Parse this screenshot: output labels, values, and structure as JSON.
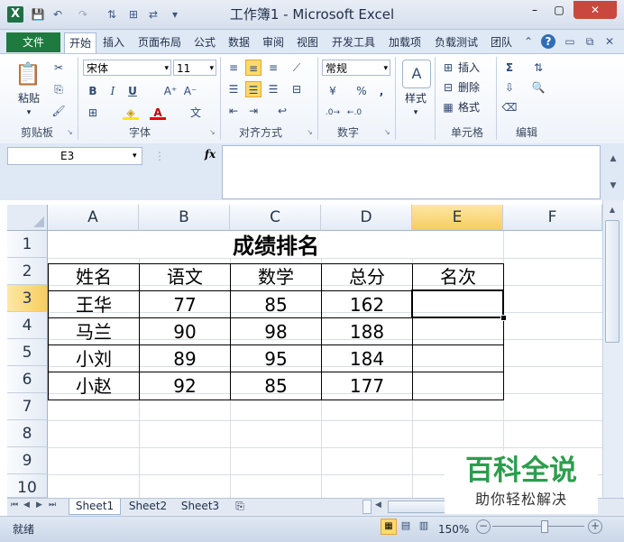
{
  "window": {
    "title": "工作簿1 - Microsoft Excel",
    "minimize": "–",
    "maximize": "▢",
    "close": "✕"
  },
  "ribbon_tabs": [
    "文件",
    "开始",
    "插入",
    "页面布局",
    "公式",
    "数据",
    "审阅",
    "视图",
    "开发工具",
    "加载项",
    "负载测试",
    "团队"
  ],
  "ribbon": {
    "clipboard": {
      "label": "剪贴板",
      "paste": "粘贴"
    },
    "font": {
      "label": "字体",
      "name": "宋体",
      "size": "11",
      "bold": "B",
      "italic": "I",
      "underline": "U"
    },
    "alignment": {
      "label": "对齐方式"
    },
    "number": {
      "label": "数字",
      "format": "常规",
      "percent": "%",
      "comma": ","
    },
    "styles": {
      "label": "样式",
      "button": "样式"
    },
    "cells": {
      "label": "单元格",
      "insert": "插入",
      "delete": "删除",
      "format": "格式"
    },
    "editing": {
      "label": "编辑",
      "sum": "Σ"
    }
  },
  "formula_bar": {
    "name_box": "E3",
    "fx": "fx",
    "formula": ""
  },
  "columns": [
    "A",
    "B",
    "C",
    "D",
    "E",
    "F"
  ],
  "rows": [
    "1",
    "2",
    "3",
    "4",
    "5",
    "6",
    "7",
    "8",
    "9",
    "10"
  ],
  "sheet": {
    "title": "成绩排名",
    "headers": [
      "姓名",
      "语文",
      "数学",
      "总分",
      "名次"
    ],
    "data": [
      [
        "王华",
        "77",
        "85",
        "162",
        ""
      ],
      [
        "马兰",
        "90",
        "98",
        "188",
        ""
      ],
      [
        "小刘",
        "89",
        "95",
        "184",
        ""
      ],
      [
        "小赵",
        "92",
        "85",
        "177",
        ""
      ]
    ]
  },
  "sheet_tabs": [
    "Sheet1",
    "Sheet2",
    "Sheet3"
  ],
  "status": {
    "ready": "就绪",
    "zoom": "150%"
  },
  "watermark": {
    "line1": "百科全说",
    "line2": "助你轻松解决"
  },
  "colors": {
    "selected_header": "#f8cc5f",
    "file_tab": "#1f7a3f",
    "watermark_green": "#2c9d4c"
  }
}
